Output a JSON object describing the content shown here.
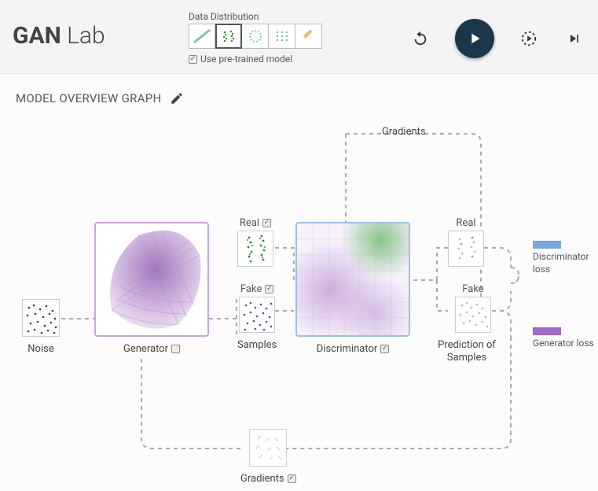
{
  "app_title_bold": "GAN",
  "app_title_light": "Lab",
  "distribution": {
    "label": "Data Distribution",
    "pretrain_label": "Use pre-trained model"
  },
  "section": {
    "title": "MODEL OVERVIEW GRAPH"
  },
  "nodes": {
    "noise": "Noise",
    "generator": "Generator",
    "samples": "Samples",
    "real": "Real",
    "fake": "Fake",
    "discriminator": "Discriminator",
    "prediction": "Prediction of Samples",
    "gradients_top": "Gradients",
    "gradients_bottom": "Gradients"
  },
  "losses": {
    "discriminator": "Discriminator loss",
    "generator": "Generator loss"
  },
  "colors": {
    "generator": "#c9a6d8",
    "discriminator": "#9bc1e9",
    "real": "#2e8b3d",
    "fake": "#6b3fa0",
    "disc_loss_bar": "#7aa7e0",
    "gen_loss_bar": "#a267c7"
  }
}
